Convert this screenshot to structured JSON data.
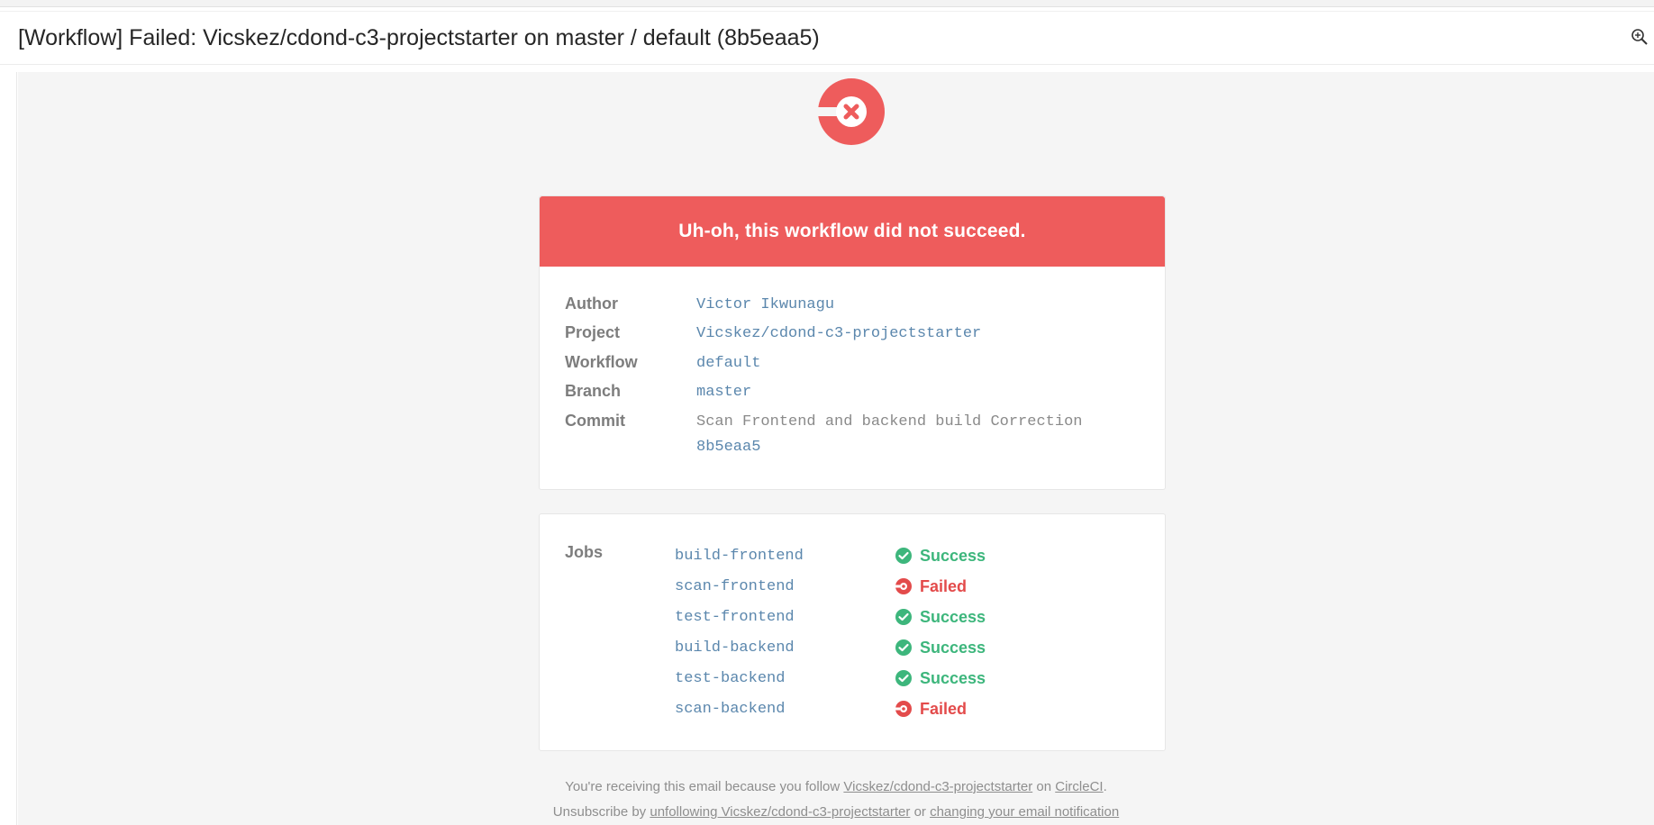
{
  "subject": {
    "title": "[Workflow] Failed: Vicskez/cdond-c3-projectstarter on master / default (8b5eaa5)"
  },
  "banner": {
    "text": "Uh-oh, this workflow did not succeed.",
    "color": "#ee5c5c"
  },
  "details": {
    "author_label": "Author",
    "author_value": "Victor Ikwunagu",
    "project_label": "Project",
    "project_value": "Vicskez/cdond-c3-projectstarter",
    "workflow_label": "Workflow",
    "workflow_value": "default",
    "branch_label": "Branch",
    "branch_value": "master",
    "commit_label": "Commit",
    "commit_message": "Scan Frontend and backend build Correction",
    "commit_hash": "8b5eaa5"
  },
  "jobs": {
    "label": "Jobs",
    "items": [
      {
        "name": "build-frontend",
        "status": "Success"
      },
      {
        "name": "scan-frontend",
        "status": "Failed"
      },
      {
        "name": "test-frontend",
        "status": "Success"
      },
      {
        "name": "build-backend",
        "status": "Success"
      },
      {
        "name": "test-backend",
        "status": "Success"
      },
      {
        "name": "scan-backend",
        "status": "Failed"
      }
    ]
  },
  "footer": {
    "line1_prefix": "You're receiving this email because you follow",
    "line1_project_link": "Vicskez/cdond-c3-projectstarter",
    "line1_middle": "on",
    "line1_circleci_link": "CircleCI",
    "line1_suffix": ".",
    "line2_prefix": "Unsubscribe by",
    "line2_unfollow_link": "unfollowing Vicskez/cdond-c3-projectstarter",
    "line2_middle": "or",
    "line2_settings_link": "changing your email notification"
  },
  "colors": {
    "success": "#3db67c",
    "failed": "#e34b4b",
    "link": "#5b87ad"
  },
  "icons": {
    "logo": "circleci-failed-logo-icon",
    "zoom": "zoom-in-icon",
    "success": "success-check-icon",
    "failed": "failed-x-icon"
  }
}
